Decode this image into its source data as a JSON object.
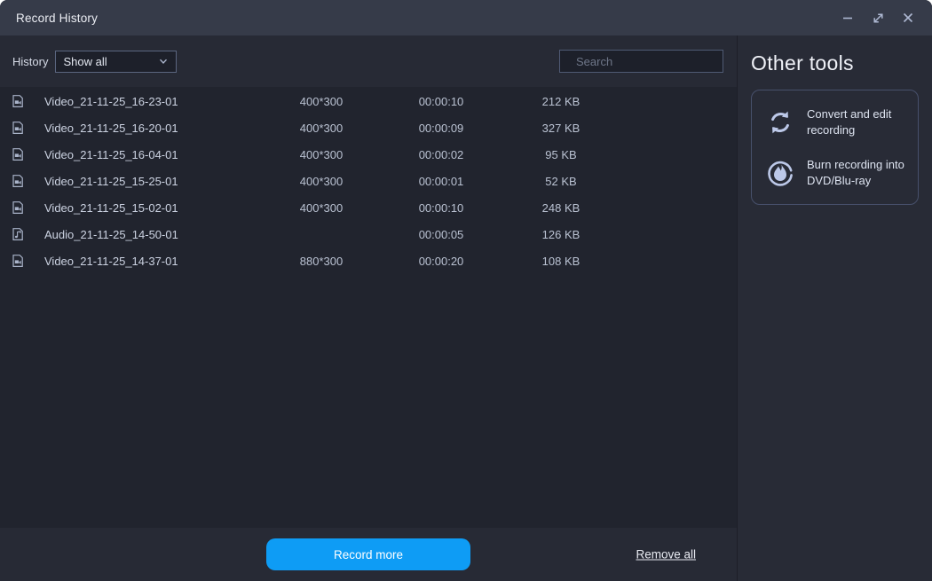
{
  "window": {
    "title": "Record History"
  },
  "titlebar": {
    "controls": [
      {
        "name": "minimize",
        "icon": "minimize-icon"
      },
      {
        "name": "maximize",
        "icon": "maximize-icon"
      },
      {
        "name": "close",
        "icon": "close-icon"
      }
    ]
  },
  "filter": {
    "label": "History",
    "selected": "Show all",
    "icon": "chevron-down-icon"
  },
  "search": {
    "placeholder": "Search",
    "icon": "search-icon"
  },
  "list": {
    "rows": [
      {
        "type": "video",
        "icon": "video-file-icon",
        "name": "Video_21-11-25_16-23-01",
        "resolution": "400*300",
        "duration": "00:00:10",
        "size": "212 KB"
      },
      {
        "type": "video",
        "icon": "video-file-icon",
        "name": "Video_21-11-25_16-20-01",
        "resolution": "400*300",
        "duration": "00:00:09",
        "size": "327 KB"
      },
      {
        "type": "video",
        "icon": "video-file-icon",
        "name": "Video_21-11-25_16-04-01",
        "resolution": "400*300",
        "duration": "00:00:02",
        "size": "95 KB"
      },
      {
        "type": "video",
        "icon": "video-file-icon",
        "name": "Video_21-11-25_15-25-01",
        "resolution": "400*300",
        "duration": "00:00:01",
        "size": "52 KB"
      },
      {
        "type": "video",
        "icon": "video-file-icon",
        "name": "Video_21-11-25_15-02-01",
        "resolution": "400*300",
        "duration": "00:00:10",
        "size": "248 KB"
      },
      {
        "type": "audio",
        "icon": "audio-file-icon",
        "name": "Audio_21-11-25_14-50-01",
        "resolution": "",
        "duration": "00:00:05",
        "size": "126 KB"
      },
      {
        "type": "video",
        "icon": "video-file-icon",
        "name": "Video_21-11-25_14-37-01",
        "resolution": "880*300",
        "duration": "00:00:20",
        "size": "108 KB"
      }
    ]
  },
  "footer": {
    "record_more": "Record more",
    "remove_all": "Remove all"
  },
  "other_tools": {
    "title": "Other tools",
    "items": [
      {
        "icon": "convert-icon",
        "label": "Convert and edit recording"
      },
      {
        "icon": "burn-icon",
        "label": "Burn recording into DVD/Blu-ray"
      }
    ]
  },
  "colors": {
    "accent_blue": "#0e9cf5",
    "titlebar_bg": "#363b49",
    "bar_bg": "#272a35",
    "list_bg": "#21242e",
    "panel_bg": "#282b36",
    "icon_periwinkle": "#bcc8e8",
    "border_slate": "#4f5a74"
  }
}
